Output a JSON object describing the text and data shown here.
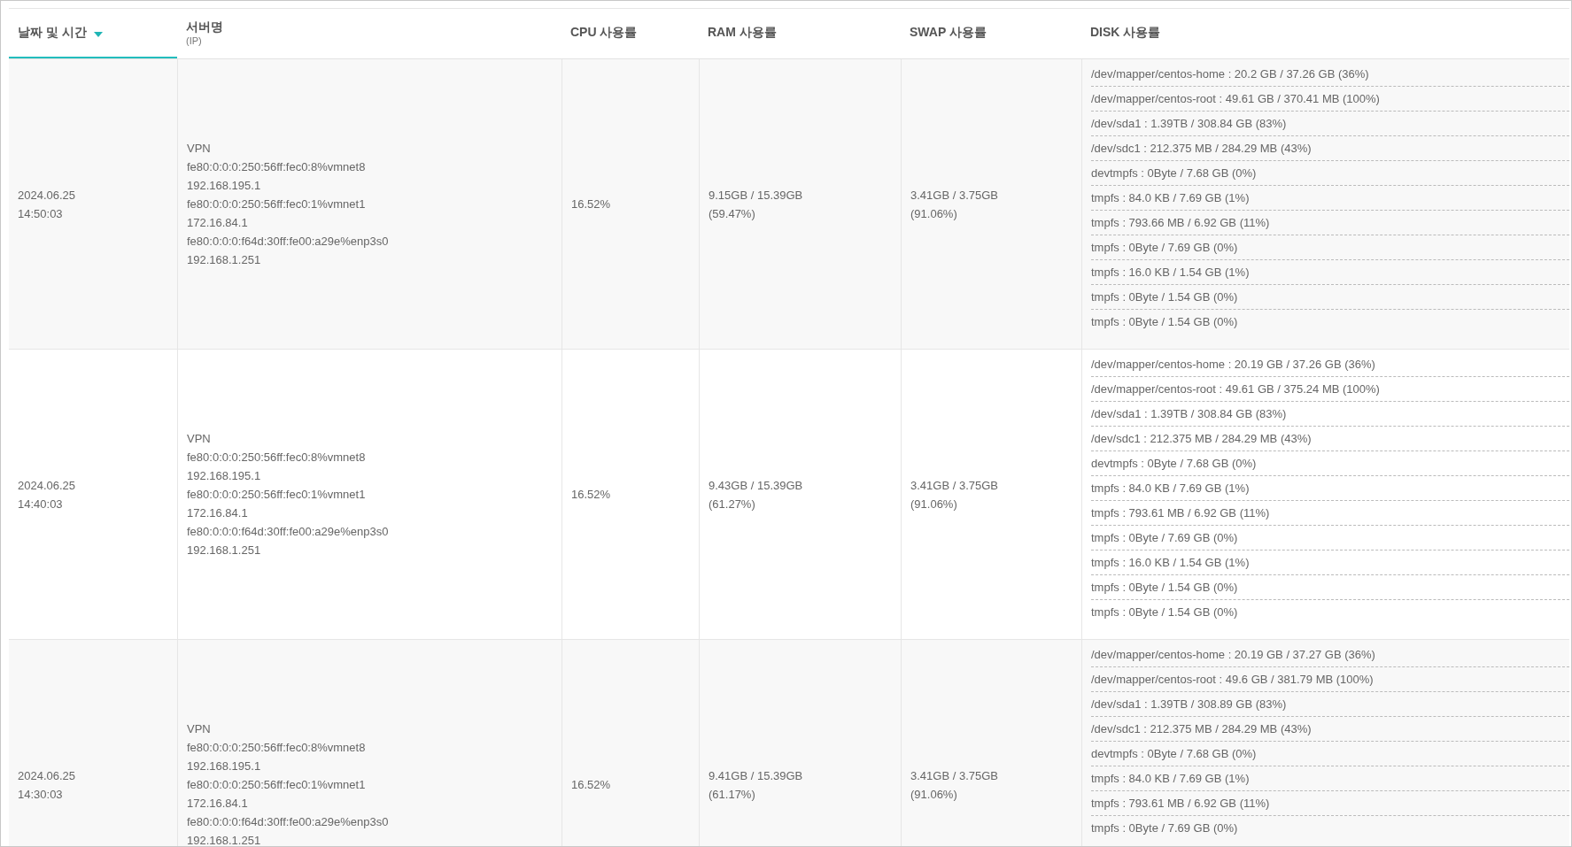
{
  "table": {
    "columns": [
      {
        "label": "날짜 및 시간",
        "sorted": true
      },
      {
        "label": "서버명",
        "sublabel": "(IP)",
        "sorted": false
      },
      {
        "label": "CPU 사용률",
        "sorted": false
      },
      {
        "label": "RAM 사용률",
        "sorted": false
      },
      {
        "label": "SWAP 사용률",
        "sorted": false
      },
      {
        "label": "DISK 사용률",
        "sorted": false
      }
    ],
    "rows": [
      {
        "datetime": "2024.06.25\n14:50:03",
        "server": "VPN\nfe80:0:0:0:250:56ff:fec0:8%vmnet8\n192.168.195.1\nfe80:0:0:0:250:56ff:fec0:1%vmnet1\n172.16.84.1\nfe80:0:0:0:f64d:30ff:fe00:a29e%enp3s0\n192.168.1.251",
        "cpu": "16.52%",
        "ram": "9.15GB / 15.39GB\n(59.47%)",
        "swap": "3.41GB / 3.75GB\n(91.06%)",
        "disks": [
          "/dev/mapper/centos-home : 20.2 GB / 37.26 GB (36%)",
          "/dev/mapper/centos-root : 49.61 GB / 370.41 MB (100%)",
          "/dev/sda1 : 1.39TB / 308.84 GB (83%)",
          "/dev/sdc1 : 212.375 MB / 284.29 MB (43%)",
          "devtmpfs : 0Byte / 7.68 GB (0%)",
          "tmpfs : 84.0 KB / 7.69 GB (1%)",
          "tmpfs : 793.66 MB / 6.92 GB (11%)",
          "tmpfs : 0Byte / 7.69 GB (0%)",
          "tmpfs : 16.0 KB / 1.54 GB (1%)",
          "tmpfs : 0Byte / 1.54 GB (0%)",
          "tmpfs : 0Byte / 1.54 GB (0%)"
        ]
      },
      {
        "datetime": "2024.06.25\n14:40:03",
        "server": "VPN\nfe80:0:0:0:250:56ff:fec0:8%vmnet8\n192.168.195.1\nfe80:0:0:0:250:56ff:fec0:1%vmnet1\n172.16.84.1\nfe80:0:0:0:f64d:30ff:fe00:a29e%enp3s0\n192.168.1.251",
        "cpu": "16.52%",
        "ram": "9.43GB / 15.39GB\n(61.27%)",
        "swap": "3.41GB / 3.75GB\n(91.06%)",
        "disks": [
          "/dev/mapper/centos-home : 20.19 GB / 37.26 GB (36%)",
          "/dev/mapper/centos-root : 49.61 GB / 375.24 MB (100%)",
          "/dev/sda1 : 1.39TB / 308.84 GB (83%)",
          "/dev/sdc1 : 212.375 MB / 284.29 MB (43%)",
          "devtmpfs : 0Byte / 7.68 GB (0%)",
          "tmpfs : 84.0 KB / 7.69 GB (1%)",
          "tmpfs : 793.61 MB / 6.92 GB (11%)",
          "tmpfs : 0Byte / 7.69 GB (0%)",
          "tmpfs : 16.0 KB / 1.54 GB (1%)",
          "tmpfs : 0Byte / 1.54 GB (0%)",
          "tmpfs : 0Byte / 1.54 GB (0%)"
        ]
      },
      {
        "datetime": "2024.06.25\n14:30:03",
        "server": "VPN\nfe80:0:0:0:250:56ff:fec0:8%vmnet8\n192.168.195.1\nfe80:0:0:0:250:56ff:fec0:1%vmnet1\n172.16.84.1\nfe80:0:0:0:f64d:30ff:fe00:a29e%enp3s0\n192.168.1.251",
        "cpu": "16.52%",
        "ram": "9.41GB / 15.39GB\n(61.17%)",
        "swap": "3.41GB / 3.75GB\n(91.06%)",
        "disks": [
          "/dev/mapper/centos-home : 20.19 GB / 37.27 GB (36%)",
          "/dev/mapper/centos-root : 49.6 GB / 381.79 MB (100%)",
          "/dev/sda1 : 1.39TB / 308.89 GB (83%)",
          "/dev/sdc1 : 212.375 MB / 284.29 MB (43%)",
          "devtmpfs : 0Byte / 7.68 GB (0%)",
          "tmpfs : 84.0 KB / 7.69 GB (1%)",
          "tmpfs : 793.61 MB / 6.92 GB (11%)",
          "tmpfs : 0Byte / 7.69 GB (0%)"
        ]
      }
    ]
  }
}
